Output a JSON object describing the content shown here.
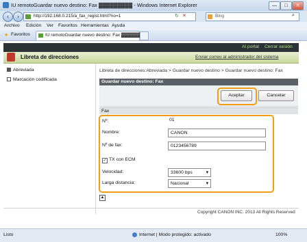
{
  "window": {
    "title": "IU remotoGuardar nuevo destino: Fax ▓▓▓▓▓▓▓▓▓ - Windows Internet Explorer",
    "min": "—",
    "max": "□",
    "close": "✕"
  },
  "address": {
    "url": "http://192.168.0.215/a_fax_regist.html?no=1",
    "search_placeholder": "Bing"
  },
  "menu": [
    "Archivo",
    "Edición",
    "Ver",
    "Favoritos",
    "Herramientas",
    "Ayuda"
  ],
  "favorites": {
    "label": "Favoritos",
    "tab_title": "IU remotoGuardar nuevo destino: Fax ▓▓▓▓▓▓▓▓"
  },
  "page": {
    "top_links": {
      "portal": "Al portal",
      "logout": "Cerrar sesión"
    },
    "header_title": "Libreta de direcciones",
    "admin_link": "Enviar correo al administrador del sistema",
    "sidebar": [
      "Abreviada",
      "Marcación codificada"
    ],
    "breadcrumb": "Libreta de direcciones:Abreviada > Guardar nuevo destino > Guardar nuevo destino: Fax",
    "panel_title": "Guardar nuevo destino: Fax",
    "accept": "Aceptar",
    "cancel": "Cancelar",
    "section_title": "Fax",
    "fields": {
      "number_label": "Nº:",
      "number_value": "01",
      "name_label": "Nombre:",
      "name_value": "CANON",
      "fax_label": "Nº de fax:",
      "fax_value": "0123456789",
      "ecm_label": "TX con ECM",
      "speed_label": "Velocidad:",
      "speed_value": "33600 bps",
      "long_label": "Larga distancia:",
      "long_value": "Nacional"
    },
    "copyright": "Copyright CANON INC. 2013 All Rights Reserved"
  },
  "status": {
    "left": "Listo",
    "zone": "Internet | Modo protegido: activado",
    "zoom": "100%"
  }
}
